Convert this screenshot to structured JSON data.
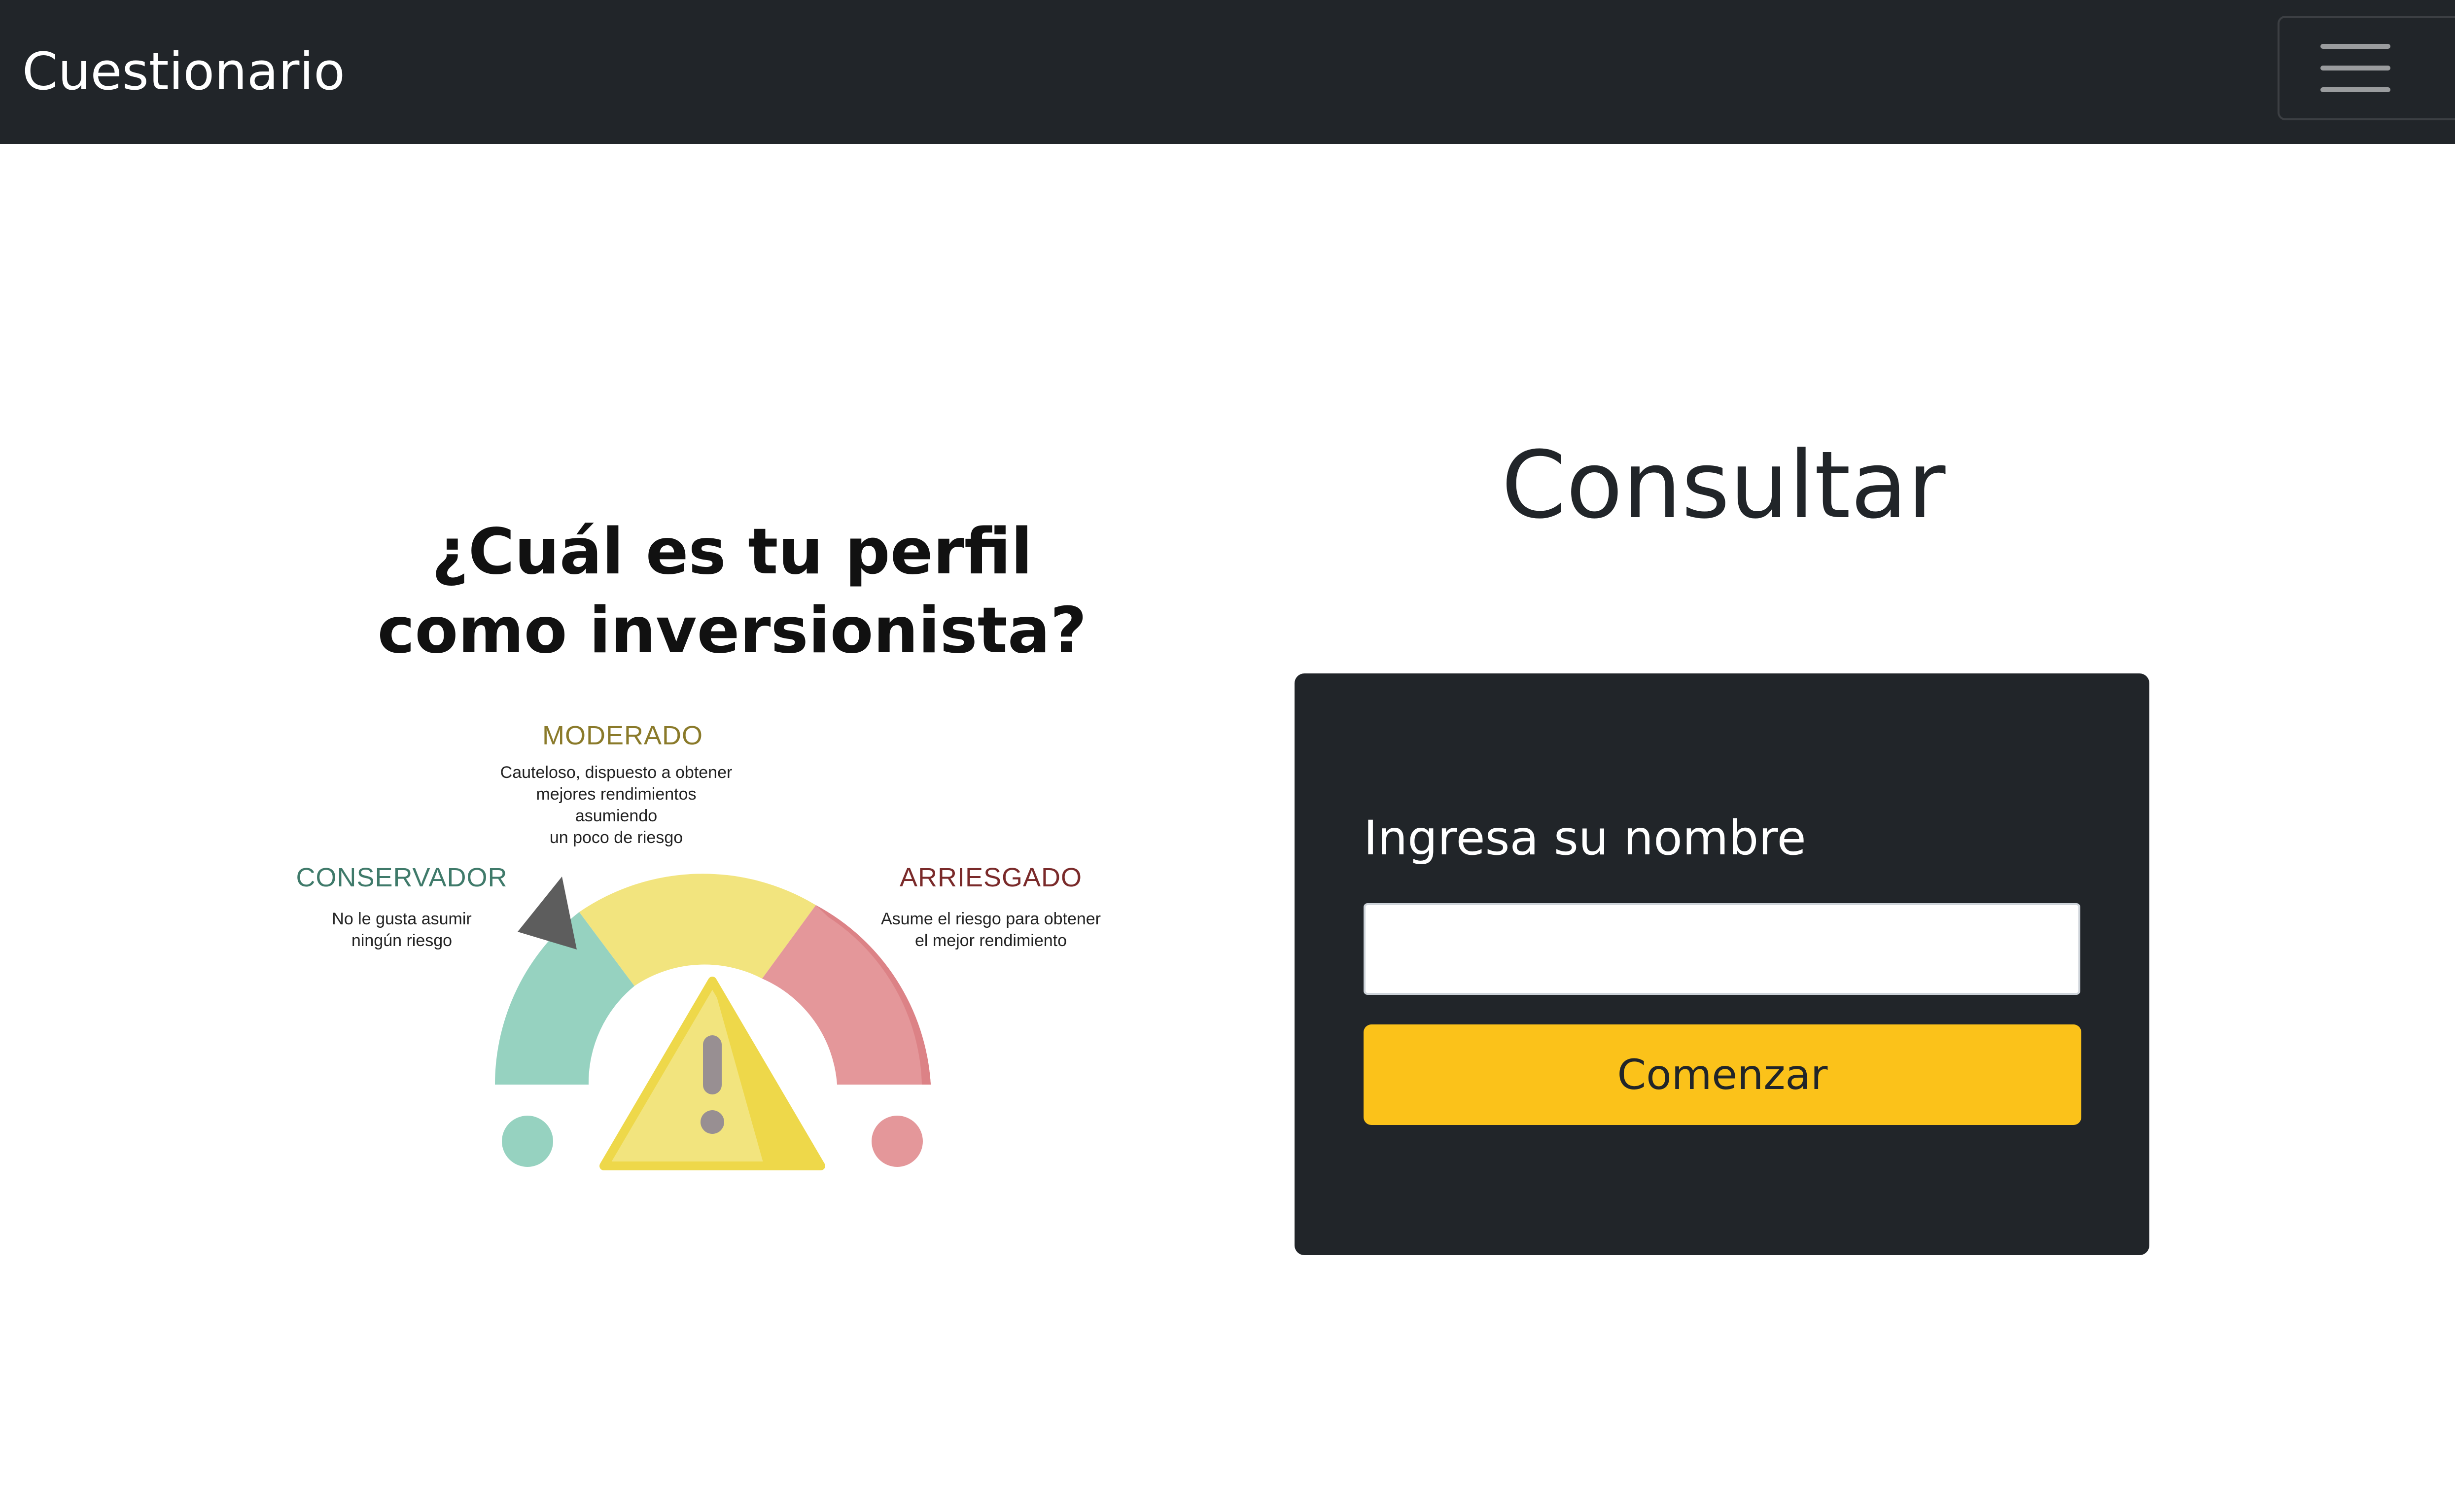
{
  "navbar": {
    "brand": "Cuestionario",
    "toggler_icon": "hamburger-menu-icon",
    "background": "#212529"
  },
  "illustration": {
    "title_line1": "¿Cuál es tu perfil",
    "title_line2": "como inversionista?",
    "profiles": {
      "moderado": {
        "name": "MODERADO",
        "description_line1": "Cauteloso, dispuesto a obtener",
        "description_line2": "mejores rendimientos asumiendo",
        "description_line3": "un poco de riesgo",
        "color": "#8a7a2a"
      },
      "conservador": {
        "name": "CONSERVADOR",
        "description_line1": "No le gusta asumir",
        "description_line2": "ningún riesgo",
        "color": "#3f7a6a"
      },
      "arriesgado": {
        "name": "ARRIESGADO",
        "description_line1": "Asume el riesgo para obtener",
        "description_line2": "el mejor rendimiento",
        "color": "#7a2a2a"
      }
    },
    "gauge_colors": {
      "green": "#96d2c0",
      "yellow": "#f2e47e",
      "red": "#e4979a",
      "warning_triangle": "#f2e47e",
      "needle": "#666666"
    },
    "icons": [
      "risk-gauge-icon",
      "warning-triangle-icon",
      "gauge-needle-icon"
    ]
  },
  "main": {
    "title": "Consultar",
    "card": {
      "label": "Ingresa su nombre",
      "input_value": "",
      "input_placeholder": "",
      "button_label": "Comenzar",
      "background": "#212529",
      "button_color": "#fbc21a"
    }
  }
}
